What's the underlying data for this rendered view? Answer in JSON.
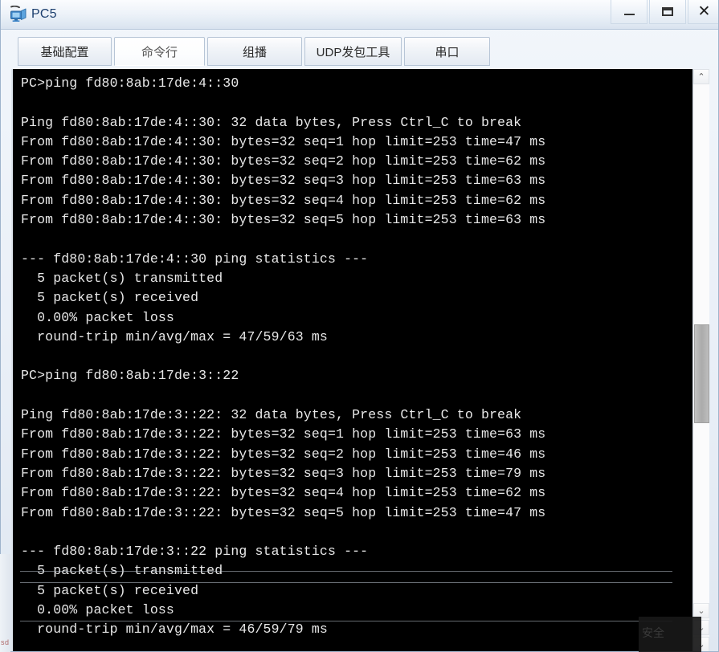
{
  "window": {
    "title": "PC5",
    "icon": "pc-computer-icon",
    "controls": {
      "minimize": "–",
      "maximize": "□",
      "close": "✕"
    }
  },
  "tabs": [
    {
      "label": "基础配置",
      "active": false
    },
    {
      "label": "命令行",
      "active": true
    },
    {
      "label": "组播",
      "active": false
    },
    {
      "label": "UDP发包工具",
      "active": false
    },
    {
      "label": "串口",
      "active": false
    }
  ],
  "terminal": {
    "background": "#000000",
    "foreground": "#e8e8e8",
    "lines": [
      "PC>ping fd80:8ab:17de:4::30",
      "",
      "Ping fd80:8ab:17de:4::30: 32 data bytes, Press Ctrl_C to break",
      "From fd80:8ab:17de:4::30: bytes=32 seq=1 hop limit=253 time=47 ms",
      "From fd80:8ab:17de:4::30: bytes=32 seq=2 hop limit=253 time=62 ms",
      "From fd80:8ab:17de:4::30: bytes=32 seq=3 hop limit=253 time=63 ms",
      "From fd80:8ab:17de:4::30: bytes=32 seq=4 hop limit=253 time=62 ms",
      "From fd80:8ab:17de:4::30: bytes=32 seq=5 hop limit=253 time=63 ms",
      "",
      "--- fd80:8ab:17de:4::30 ping statistics ---",
      "  5 packet(s) transmitted",
      "  5 packet(s) received",
      "  0.00% packet loss",
      "  round-trip min/avg/max = 47/59/63 ms",
      "",
      "PC>ping fd80:8ab:17de:3::22",
      "",
      "Ping fd80:8ab:17de:3::22: 32 data bytes, Press Ctrl_C to break",
      "From fd80:8ab:17de:3::22: bytes=32 seq=1 hop limit=253 time=63 ms",
      "From fd80:8ab:17de:3::22: bytes=32 seq=2 hop limit=253 time=46 ms",
      "From fd80:8ab:17de:3::22: bytes=32 seq=3 hop limit=253 time=79 ms",
      "From fd80:8ab:17de:3::22: bytes=32 seq=4 hop limit=253 time=62 ms",
      "From fd80:8ab:17de:3::22: bytes=32 seq=5 hop limit=253 time=47 ms",
      "",
      "--- fd80:8ab:17de:3::22 ping statistics ---",
      "  5 packet(s) transmitted",
      "  5 packet(s) received",
      "  0.00% packet loss",
      "  round-trip min/avg/max = 46/59/79 ms"
    ]
  },
  "scrollbar": {
    "up_arrow": "⌃",
    "down_arrow": "⌄"
  },
  "artifacts": {
    "bottom_left_text": "sd",
    "badge_text": "安全"
  }
}
